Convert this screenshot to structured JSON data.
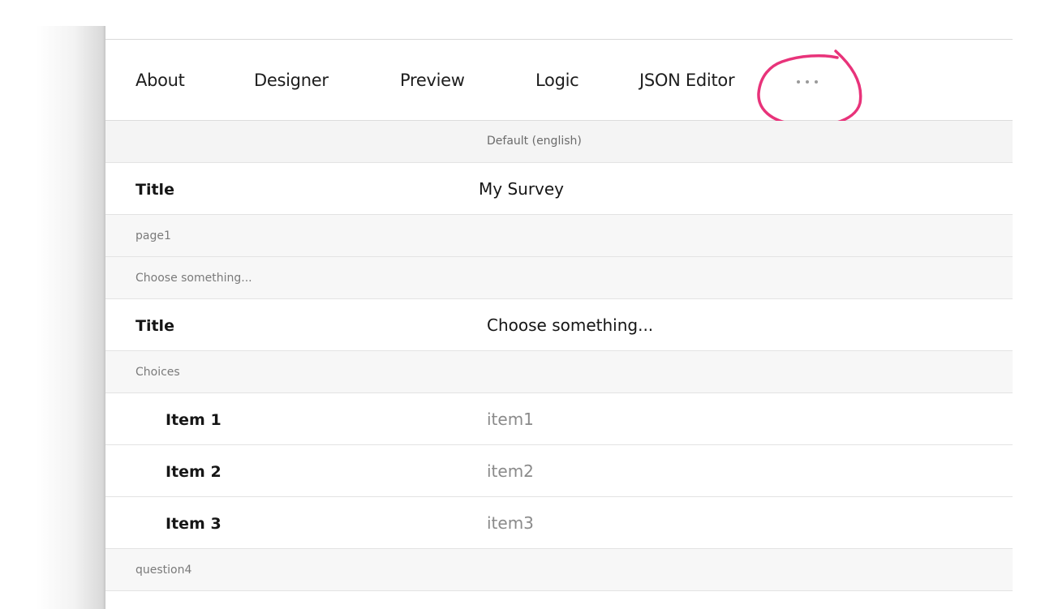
{
  "tabs": [
    {
      "label": "About"
    },
    {
      "label": "Designer"
    },
    {
      "label": "Preview"
    },
    {
      "label": "Logic"
    },
    {
      "label": "JSON Editor"
    }
  ],
  "more_tab": {
    "icon": "more-horizontal-icon"
  },
  "annotation": {
    "color": "#e8337a"
  },
  "language_header": "Default (english)",
  "survey": {
    "title_label": "Title",
    "title_value": "My Survey"
  },
  "page": {
    "name": "page1"
  },
  "question": {
    "name": "Choose something...",
    "title_label": "Title",
    "title_value": "Choose something...",
    "choices_label": "Choices",
    "choices": [
      {
        "label": "Item 1",
        "value": "item1"
      },
      {
        "label": "Item 2",
        "value": "item2"
      },
      {
        "label": "Item 3",
        "value": "item3"
      }
    ]
  },
  "next_question": {
    "name": "question4"
  }
}
